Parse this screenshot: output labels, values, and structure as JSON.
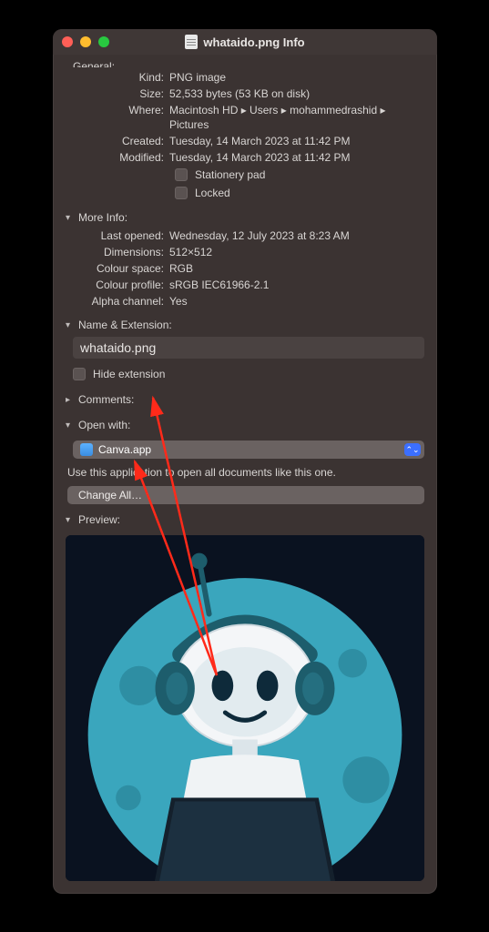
{
  "window": {
    "title": "whataido.png Info"
  },
  "general": {
    "kind_label": "Kind:",
    "kind_value": "PNG image",
    "size_label": "Size:",
    "size_value": "52,533 bytes (53 KB on disk)",
    "where_label": "Where:",
    "where_value": "Macintosh HD ▸ Users ▸ mohammedrashid ▸ Pictures",
    "created_label": "Created:",
    "created_value": "Tuesday, 14 March 2023 at 11:42 PM",
    "modified_label": "Modified:",
    "modified_value": "Tuesday, 14 March 2023 at 11:42 PM",
    "stationery_label": "Stationery pad",
    "locked_label": "Locked"
  },
  "more_info": {
    "header": "More Info:",
    "last_opened_label": "Last opened:",
    "last_opened_value": "Wednesday, 12 July 2023 at 8:23 AM",
    "dimensions_label": "Dimensions:",
    "dimensions_value": "512×512",
    "colour_space_label": "Colour space:",
    "colour_space_value": "RGB",
    "colour_profile_label": "Colour profile:",
    "colour_profile_value": "sRGB IEC61966-2.1",
    "alpha_label": "Alpha channel:",
    "alpha_value": "Yes"
  },
  "name_ext": {
    "header": "Name & Extension:",
    "value": "whataido.png",
    "hide_label": "Hide extension"
  },
  "comments": {
    "header": "Comments:"
  },
  "open_with": {
    "header": "Open with:",
    "app": "Canva.app",
    "hint": "Use this application to open all documents like this one.",
    "change_all": "Change All…"
  },
  "preview": {
    "header": "Preview:"
  }
}
